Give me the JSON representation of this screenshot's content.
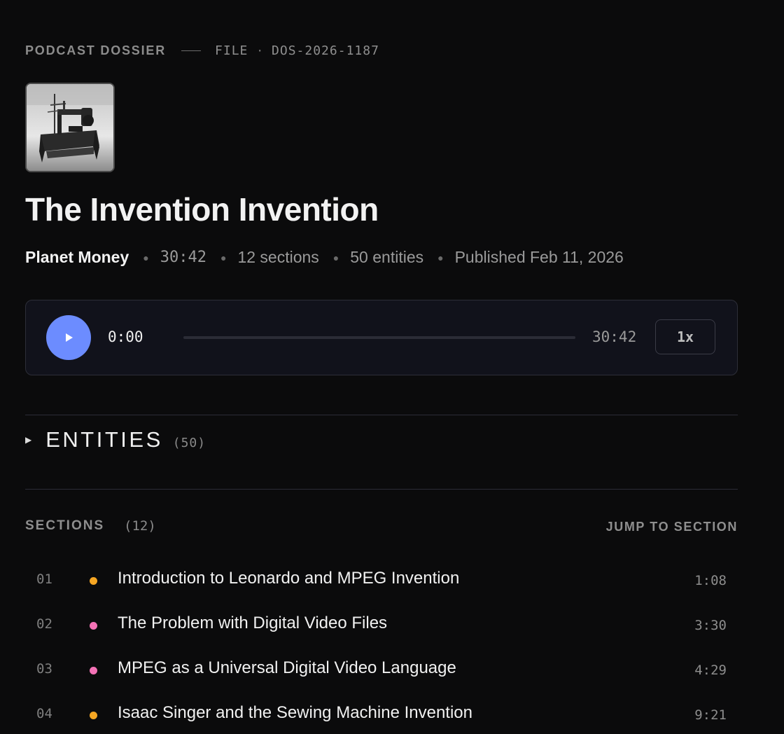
{
  "header": {
    "kicker": "PODCAST DOSSIER",
    "file_label": "FILE",
    "file_id": "DOS-2026-1187"
  },
  "cover": {
    "icon": "sewing-machine-photo"
  },
  "episode": {
    "title": "The Invention Invention",
    "show": "Planet Money",
    "duration": "30:42",
    "sections_text": "12 sections",
    "entities_text": "50 entities",
    "published": "Published Feb 11, 2026"
  },
  "player": {
    "current_time": "0:00",
    "duration": "30:42",
    "progress": 0,
    "speed": "1x",
    "accent": "#6c8cff"
  },
  "entities": {
    "label": "ENTITIES",
    "count": "(50)"
  },
  "sections": {
    "label": "SECTIONS",
    "count": "(12)",
    "jump_label": "JUMP TO SECTION",
    "items": [
      {
        "num": "01",
        "title": "Introduction to Leonardo and MPEG Invention",
        "time": "1:08",
        "color": "#f5a623"
      },
      {
        "num": "02",
        "title": "The Problem with Digital Video Files",
        "time": "3:30",
        "color": "#f472b6"
      },
      {
        "num": "03",
        "title": "MPEG as a Universal Digital Video Language",
        "time": "4:29",
        "color": "#f472b6"
      },
      {
        "num": "04",
        "title": "Isaac Singer and the Sewing Machine Invention",
        "time": "9:21",
        "color": "#f5a623"
      }
    ]
  }
}
